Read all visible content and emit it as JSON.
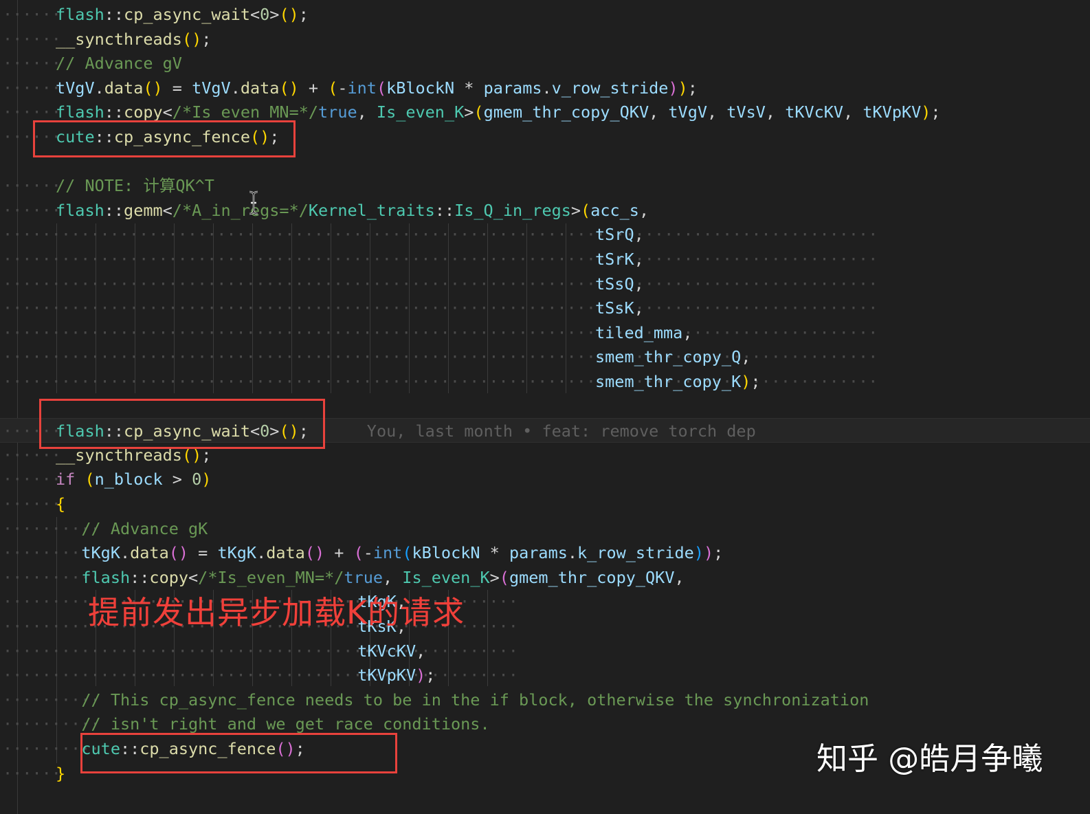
{
  "editor": {
    "lines": [
      {
        "indent": "······",
        "tokens": [
          [
            "flash",
            "ns"
          ],
          [
            "::",
            "op"
          ],
          [
            "cp_async_wait",
            "fn"
          ],
          [
            "<",
            "op"
          ],
          [
            "0",
            "num"
          ],
          [
            ">",
            "op"
          ],
          [
            "()",
            "b1"
          ],
          [
            ";",
            "op"
          ]
        ]
      },
      {
        "indent": "······",
        "tokens": [
          [
            "__syncthreads",
            "fn"
          ],
          [
            "()",
            "b1"
          ],
          [
            ";",
            "op"
          ]
        ]
      },
      {
        "indent": "······",
        "tokens": [
          [
            "// Advance gV",
            "cmt"
          ]
        ]
      },
      {
        "indent": "······",
        "tokens": [
          [
            "tVgV",
            "var"
          ],
          [
            ".",
            "op"
          ],
          [
            "data",
            "fn"
          ],
          [
            "()",
            "b1"
          ],
          [
            " = ",
            "op"
          ],
          [
            "tVgV",
            "var"
          ],
          [
            ".",
            "op"
          ],
          [
            "data",
            "fn"
          ],
          [
            "()",
            "b1"
          ],
          [
            " + ",
            "op"
          ],
          [
            "(",
            "b1"
          ],
          [
            "-",
            "op"
          ],
          [
            "int",
            "type"
          ],
          [
            "(",
            "b2"
          ],
          [
            "kBlockN",
            "var"
          ],
          [
            " * ",
            "op"
          ],
          [
            "params",
            "var"
          ],
          [
            ".",
            "op"
          ],
          [
            "v_row_stride",
            "var"
          ],
          [
            ")",
            "b2"
          ],
          [
            ")",
            "b1"
          ],
          [
            ";",
            "op"
          ]
        ]
      },
      {
        "indent": "······",
        "tokens": [
          [
            "flash",
            "ns"
          ],
          [
            "::",
            "op"
          ],
          [
            "copy",
            "fn"
          ],
          [
            "<",
            "op"
          ],
          [
            "/*Is_even_MN=*/",
            "cmt"
          ],
          [
            "true",
            "type"
          ],
          [
            ", ",
            "op"
          ],
          [
            "Is_even_K",
            "ns"
          ],
          [
            ">",
            "op"
          ],
          [
            "(",
            "b1"
          ],
          [
            "gmem_thr_copy_QKV",
            "var"
          ],
          [
            ", ",
            "op"
          ],
          [
            "tVgV",
            "var"
          ],
          [
            ", ",
            "op"
          ],
          [
            "tVsV",
            "var"
          ],
          [
            ", ",
            "op"
          ],
          [
            "tKVcKV",
            "var"
          ],
          [
            ", ",
            "op"
          ],
          [
            "tKVpKV",
            "var"
          ],
          [
            ")",
            "b1"
          ],
          [
            ";",
            "op"
          ]
        ]
      },
      {
        "indent": "······",
        "tokens": [
          [
            "cute",
            "ns"
          ],
          [
            "::",
            "op"
          ],
          [
            "cp_async_fence",
            "fn"
          ],
          [
            "()",
            "b1"
          ],
          [
            ";",
            "op"
          ]
        ]
      },
      {
        "indent": "",
        "tokens": []
      },
      {
        "indent": "······",
        "tokens": [
          [
            "// NOTE: 计算QK^T",
            "cmt"
          ]
        ]
      },
      {
        "indent": "······",
        "tokens": [
          [
            "flash",
            "ns"
          ],
          [
            "::",
            "op"
          ],
          [
            "gemm",
            "fn"
          ],
          [
            "<",
            "op"
          ],
          [
            "/*A_in_regs=*/",
            "cmt"
          ],
          [
            "Kernel_traits",
            "ns"
          ],
          [
            "::",
            "op"
          ],
          [
            "Is_Q_in_regs",
            "ns"
          ],
          [
            ">",
            "op"
          ],
          [
            "(",
            "b1"
          ],
          [
            "acc_s",
            "var"
          ],
          [
            ",",
            "op"
          ]
        ]
      },
      {
        "indent": "··························································································",
        "tokens": [
          [
            "tSrQ",
            "var"
          ],
          [
            ",",
            "op"
          ]
        ]
      },
      {
        "indent": "··························································································",
        "tokens": [
          [
            "tSrK",
            "var"
          ],
          [
            ",",
            "op"
          ]
        ]
      },
      {
        "indent": "··························································································",
        "tokens": [
          [
            "tSsQ",
            "var"
          ],
          [
            ",",
            "op"
          ]
        ]
      },
      {
        "indent": "··························································································",
        "tokens": [
          [
            "tSsK",
            "var"
          ],
          [
            ",",
            "op"
          ]
        ]
      },
      {
        "indent": "··························································································",
        "tokens": [
          [
            "tiled_mma",
            "var"
          ],
          [
            ",",
            "op"
          ]
        ]
      },
      {
        "indent": "··························································································",
        "tokens": [
          [
            "smem_thr_copy_Q",
            "var"
          ],
          [
            ",",
            "op"
          ]
        ]
      },
      {
        "indent": "··························································································",
        "tokens": [
          [
            "smem_thr_copy_K",
            "var"
          ],
          [
            ")",
            "b1"
          ],
          [
            ";",
            "op"
          ]
        ]
      },
      {
        "indent": "",
        "tokens": []
      },
      {
        "indent": "······",
        "current": true,
        "tokens": [
          [
            "flash",
            "ns"
          ],
          [
            "::",
            "op"
          ],
          [
            "cp_async_wait",
            "fn"
          ],
          [
            "<",
            "op"
          ],
          [
            "0",
            "num"
          ],
          [
            ">",
            "op"
          ],
          [
            "()",
            "b1"
          ],
          [
            ";",
            "op"
          ],
          [
            "      You, last month • feat: remove torch dep",
            "blame"
          ]
        ]
      },
      {
        "indent": "······",
        "tokens": [
          [
            "__syncthreads",
            "fn"
          ],
          [
            "()",
            "b1"
          ],
          [
            ";",
            "op"
          ]
        ]
      },
      {
        "indent": "······",
        "tokens": [
          [
            "if",
            "kw"
          ],
          [
            " ",
            "op"
          ],
          [
            "(",
            "b1"
          ],
          [
            "n_block",
            "var"
          ],
          [
            " > ",
            "op"
          ],
          [
            "0",
            "num"
          ],
          [
            ")",
            "b1"
          ]
        ]
      },
      {
        "indent": "······",
        "tokens": [
          [
            "{",
            "b1"
          ]
        ]
      },
      {
        "indent": "··········",
        "tokens": [
          [
            "// Advance gK",
            "cmt"
          ]
        ]
      },
      {
        "indent": "··········",
        "tokens": [
          [
            "tKgK",
            "var"
          ],
          [
            ".",
            "op"
          ],
          [
            "data",
            "fn"
          ],
          [
            "()",
            "b2"
          ],
          [
            " = ",
            "op"
          ],
          [
            "tKgK",
            "var"
          ],
          [
            ".",
            "op"
          ],
          [
            "data",
            "fn"
          ],
          [
            "()",
            "b2"
          ],
          [
            " + ",
            "op"
          ],
          [
            "(",
            "b2"
          ],
          [
            "-",
            "op"
          ],
          [
            "int",
            "type"
          ],
          [
            "(",
            "b3"
          ],
          [
            "kBlockN",
            "var"
          ],
          [
            " * ",
            "op"
          ],
          [
            "params",
            "var"
          ],
          [
            ".",
            "op"
          ],
          [
            "k_row_stride",
            "var"
          ],
          [
            ")",
            "b3"
          ],
          [
            ")",
            "b2"
          ],
          [
            ";",
            "op"
          ]
        ]
      },
      {
        "indent": "··········",
        "tokens": [
          [
            "flash",
            "ns"
          ],
          [
            "::",
            "op"
          ],
          [
            "copy",
            "fn"
          ],
          [
            "<",
            "op"
          ],
          [
            "/*Is_even_MN=*/",
            "cmt"
          ],
          [
            "true",
            "type"
          ],
          [
            ", ",
            "op"
          ],
          [
            "Is_even_K",
            "ns"
          ],
          [
            ">",
            "op"
          ],
          [
            "(",
            "b2"
          ],
          [
            "gmem_thr_copy_QKV",
            "var"
          ],
          [
            ",",
            "op"
          ]
        ]
      },
      {
        "indent": "·····················································",
        "tokens": [
          [
            "tKgK",
            "var"
          ],
          [
            ",",
            "op"
          ]
        ]
      },
      {
        "indent": "·····················································",
        "tokens": [
          [
            "tKsK",
            "var"
          ],
          [
            ",",
            "op"
          ]
        ]
      },
      {
        "indent": "·····················································",
        "tokens": [
          [
            "tKVcKV",
            "var"
          ],
          [
            ",",
            "op"
          ]
        ]
      },
      {
        "indent": "·····················································",
        "tokens": [
          [
            "tKVpKV",
            "var"
          ],
          [
            ")",
            "b2"
          ],
          [
            ";",
            "op"
          ]
        ]
      },
      {
        "indent": "··········",
        "tokens": [
          [
            "// This cp_async_fence needs to be in the if block, otherwise the synchronization",
            "cmt"
          ]
        ]
      },
      {
        "indent": "··········",
        "tokens": [
          [
            "// isn't right and we get race conditions.",
            "cmt"
          ]
        ]
      },
      {
        "indent": "··········",
        "tokens": [
          [
            "cute",
            "ns"
          ],
          [
            "::",
            "op"
          ],
          [
            "cp_async_fence",
            "fn"
          ],
          [
            "()",
            "b2"
          ],
          [
            ";",
            "op"
          ]
        ]
      },
      {
        "indent": "······",
        "tokens": [
          [
            "}",
            "b1"
          ]
        ]
      }
    ]
  },
  "annotation": {
    "note": "提前发出异步加载K的请求"
  },
  "watermark": {
    "text": "知乎 @皓月争曦"
  },
  "icons": {
    "cursor": "text-cursor-icon"
  }
}
